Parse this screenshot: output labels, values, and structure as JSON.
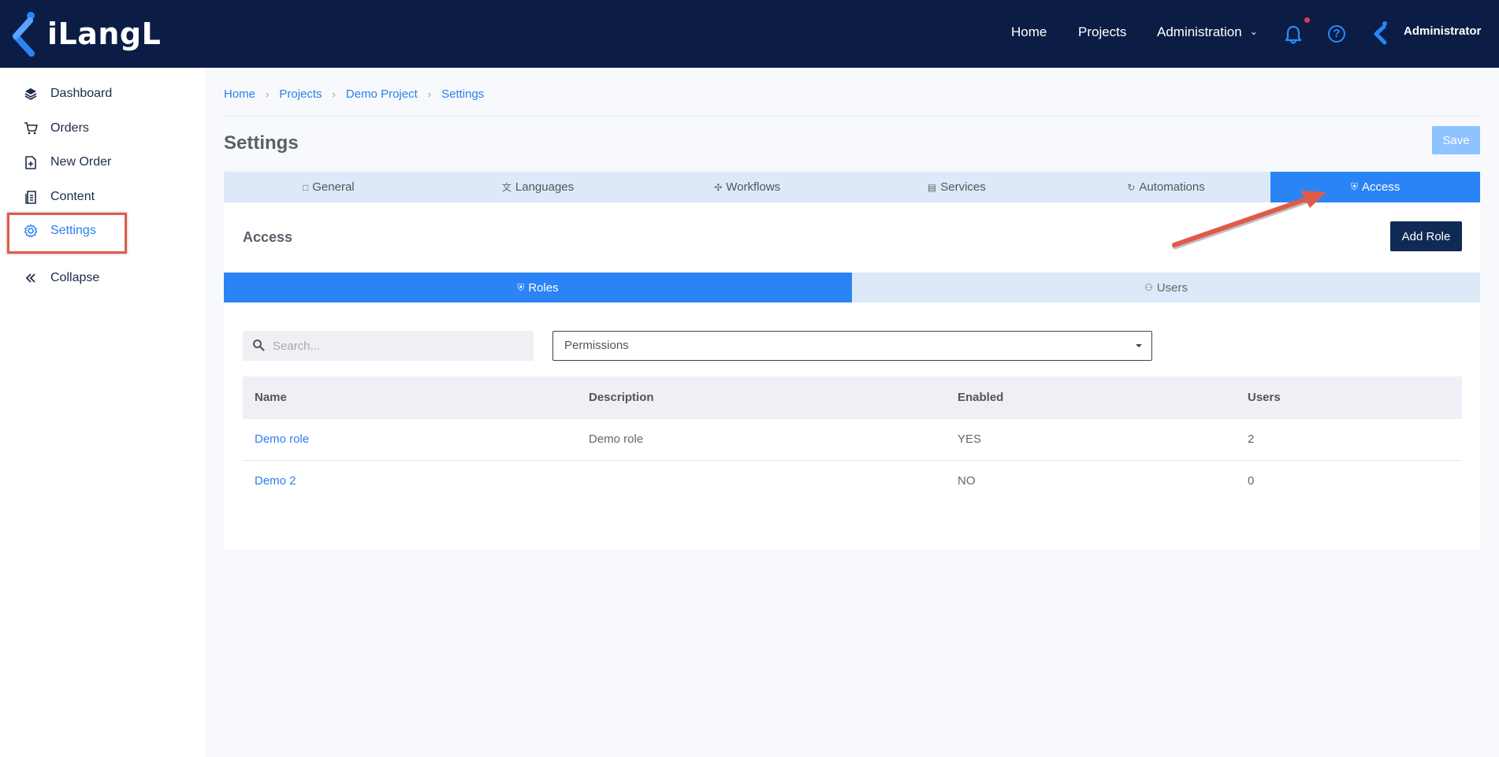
{
  "app": {
    "name": "iLangL"
  },
  "topnav": {
    "items": [
      {
        "label": "Home"
      },
      {
        "label": "Projects"
      },
      {
        "label": "Administration"
      }
    ],
    "user": "Administrator"
  },
  "sidebar": {
    "items": [
      {
        "label": "Dashboard",
        "icon": "layers-icon"
      },
      {
        "label": "Orders",
        "icon": "cart-icon"
      },
      {
        "label": "New Order",
        "icon": "file-plus-icon"
      },
      {
        "label": "Content",
        "icon": "document-icon"
      },
      {
        "label": "Settings",
        "icon": "gear-icon",
        "active": true
      },
      {
        "label": "Collapse",
        "icon": "chevrons-left-icon"
      }
    ]
  },
  "breadcrumb": [
    "Home",
    "Projects",
    "Demo Project",
    "Settings"
  ],
  "page": {
    "title": "Settings",
    "save_label": "Save"
  },
  "tabs": [
    {
      "label": "General",
      "icon": "window-icon"
    },
    {
      "label": "Languages",
      "icon": "translate-icon"
    },
    {
      "label": "Workflows",
      "icon": "workflow-icon"
    },
    {
      "label": "Services",
      "icon": "server-icon"
    },
    {
      "label": "Automations",
      "icon": "refresh-icon"
    },
    {
      "label": "Access",
      "icon": "shield-icon",
      "active": true
    }
  ],
  "access": {
    "title": "Access",
    "add_role_label": "Add Role",
    "subtabs": [
      {
        "label": "Roles",
        "icon": "shield-icon",
        "active": true
      },
      {
        "label": "Users",
        "icon": "users-icon"
      }
    ],
    "search_placeholder": "Search...",
    "permissions_select": "Permissions",
    "table": {
      "columns": [
        "Name",
        "Description",
        "Enabled",
        "Users"
      ],
      "rows": [
        {
          "name": "Demo role",
          "description": "Demo role",
          "enabled": "YES",
          "users": "2"
        },
        {
          "name": "Demo 2",
          "description": "",
          "enabled": "NO",
          "users": "0"
        }
      ]
    }
  },
  "colors": {
    "topbar": "#0b1d45",
    "accent": "#2a84f5",
    "annotation": "#e05a4a"
  }
}
